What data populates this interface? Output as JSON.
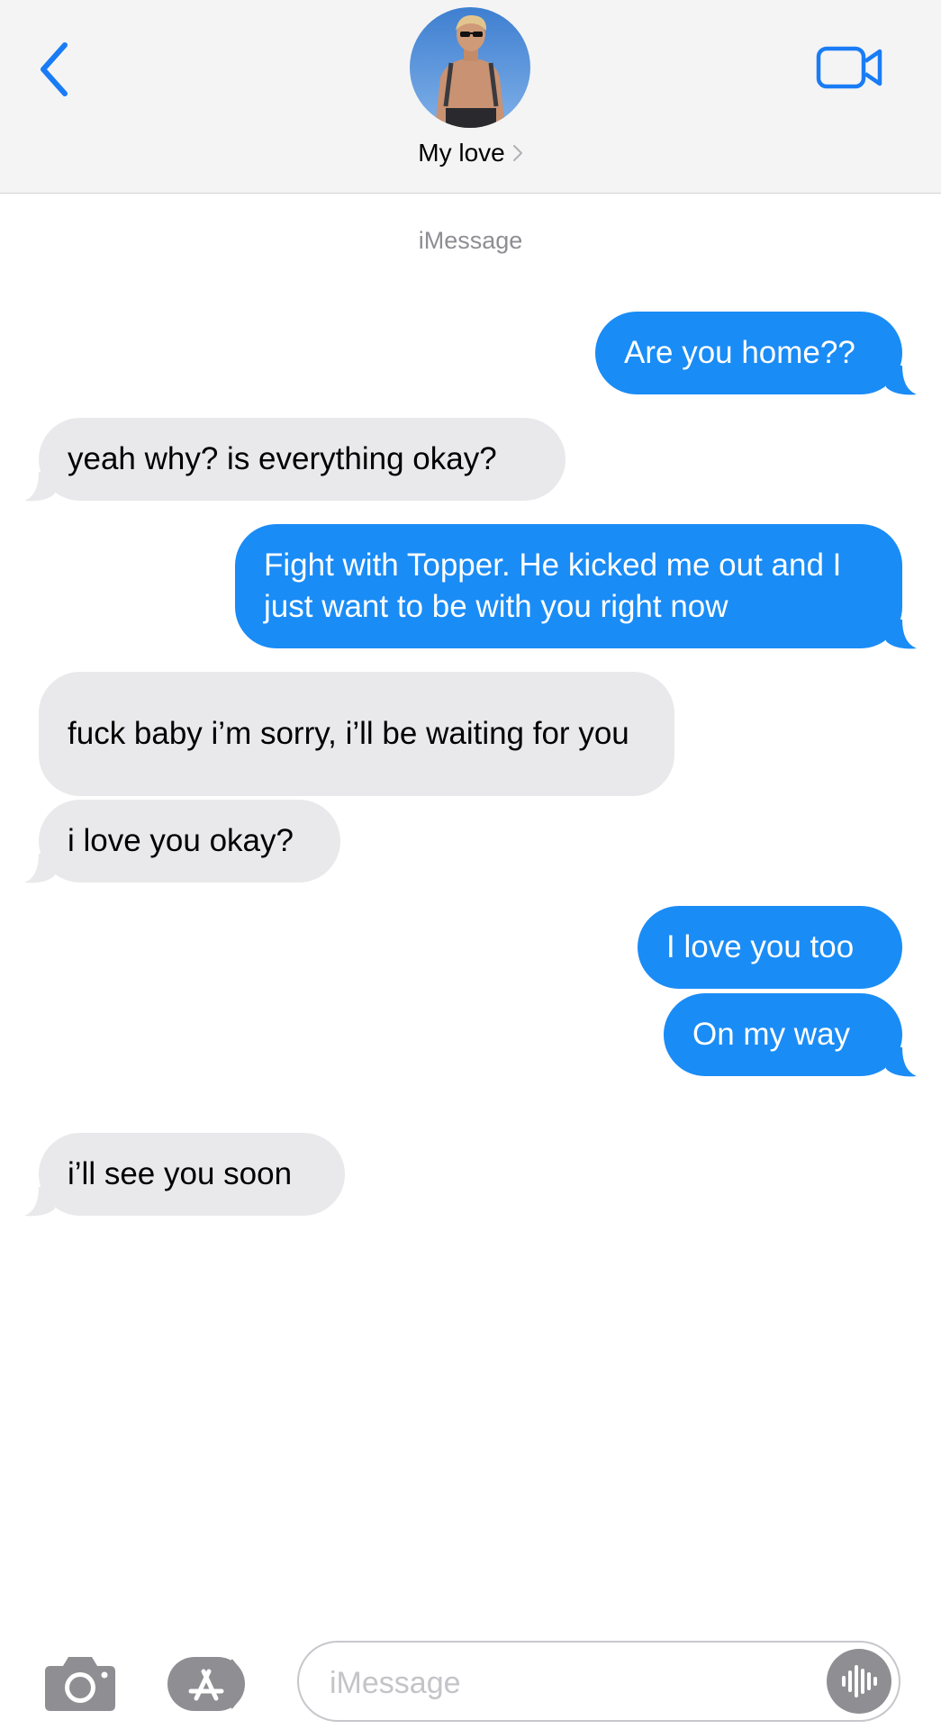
{
  "header": {
    "contact_name": "My love"
  },
  "service_label": "iMessage",
  "messages": [
    {
      "direction": "outgoing",
      "text": "Are you home??"
    },
    {
      "direction": "incoming",
      "text": "yeah why? is everything okay?"
    },
    {
      "direction": "outgoing",
      "text": "Fight with Topper. He kicked me out and I just want to be with you right now"
    },
    {
      "direction": "incoming",
      "text": "fuck baby i’m sorry, i’ll be waiting for you"
    },
    {
      "direction": "incoming",
      "text": "i love you okay?"
    },
    {
      "direction": "outgoing",
      "text": "I love you too"
    },
    {
      "direction": "outgoing",
      "text": "On my way"
    },
    {
      "direction": "incoming",
      "text": "i’ll see you soon"
    }
  ],
  "composer": {
    "placeholder": "iMessage"
  },
  "colors": {
    "accent": "#1a8cf6",
    "incoming_bubble": "#e9e9eb",
    "header_bg": "#f4f4f5"
  },
  "icons": [
    "back-chevron-icon",
    "video-camera-icon",
    "camera-icon",
    "app-store-icon",
    "audio-waveform-icon"
  ]
}
